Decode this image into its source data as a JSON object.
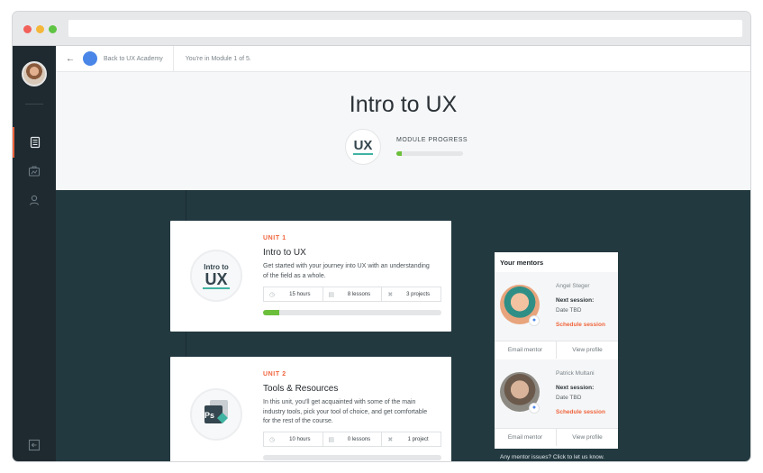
{
  "topbar": {
    "back_label": "Back to UX Academy",
    "module_note": "You're in Module 1 of 5."
  },
  "hero": {
    "title": "Intro to UX",
    "badge_text": "UX",
    "progress_label": "MODULE PROGRESS",
    "progress_value": 0.08
  },
  "units": [
    {
      "kicker": "UNIT 1",
      "title": "Intro to UX",
      "icon_line1": "Intro to",
      "icon_line2": "UX",
      "description": "Get started with your journey into UX with an understanding of the field as a whole.",
      "hours": "15 hours",
      "lessons": "8 lessons",
      "projects": "3 projects",
      "progress_value": 0.09
    },
    {
      "kicker": "UNIT 2",
      "title": "Tools & Resources",
      "icon_text": "Ps",
      "description": "In this unit, you'll get acquainted with some of the main industry tools, pick your tool of choice, and get comfortable for the rest of the course.",
      "hours": "10 hours",
      "lessons": "0 lessons",
      "projects": "1 project"
    }
  ],
  "mentors_panel": {
    "heading": "Your mentors",
    "mentors": [
      {
        "name": "Angel Steger",
        "next_label": "Next session:",
        "date": "Date TBD",
        "schedule": "Schedule session",
        "email": "Email mentor",
        "profile": "View profile"
      },
      {
        "name": "Patrick Multani",
        "next_label": "Next session:",
        "date": "Date TBD",
        "schedule": "Schedule session",
        "email": "Email mentor",
        "profile": "View profile"
      }
    ],
    "issues_link": "Any mentor issues? Click to let us know."
  },
  "icons": {
    "back": "arrow-left-icon",
    "sidebar": [
      "user-avatar",
      "notebook-icon",
      "portfolio-icon",
      "profile-icon",
      "collapse-icon"
    ],
    "stats": [
      "clock-icon",
      "book-icon",
      "project-icon"
    ]
  },
  "colors": {
    "accent": "#f0643c",
    "progress": "#6bbf3b",
    "teal": "#41b3a3",
    "sidebar": "#1f2a30",
    "content_bg": "#233940"
  }
}
